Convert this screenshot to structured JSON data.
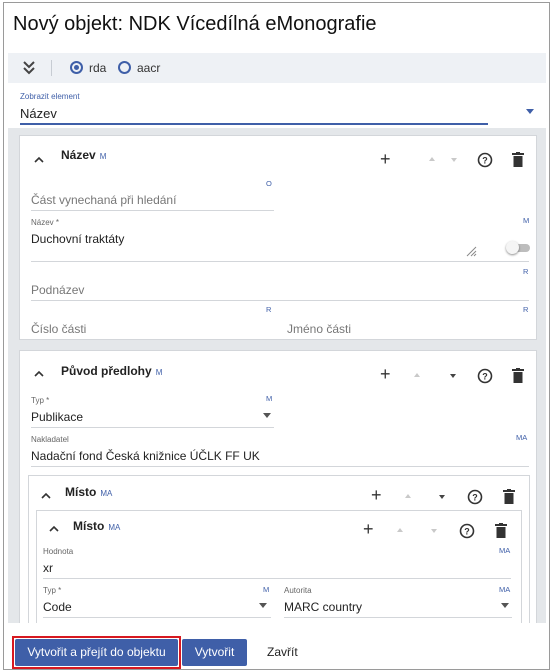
{
  "dialog": {
    "title": "Nový objekt: NDK Vícedílná eMonografie"
  },
  "toolbar": {
    "expand_icon": "double-chevron-down-icon",
    "radios": [
      {
        "label": "rda",
        "checked": true
      },
      {
        "label": "aacr",
        "checked": false
      }
    ]
  },
  "element_select": {
    "label": "Zobrazit element",
    "value": "Název"
  },
  "nazev_panel": {
    "title": "Název",
    "tag": "M",
    "fields": {
      "cast_vynechana": {
        "placeholder": "Část vynechaná při hledání",
        "tag": "O"
      },
      "nazev": {
        "label": "Název *",
        "value": "Duchovní traktáty",
        "tag": "M",
        "toggle_on": false
      },
      "podnazev": {
        "placeholder": "Podnázev",
        "tag": "R"
      },
      "cislo_casti": {
        "placeholder": "Číslo části",
        "tag": "R"
      },
      "jmeno_casti": {
        "placeholder": "Jméno části",
        "tag": "R"
      }
    }
  },
  "puvod_panel": {
    "title": "Původ předlohy",
    "tag": "M",
    "typ": {
      "label": "Typ *",
      "value": "Publikace",
      "tag": "M"
    },
    "nakladatel": {
      "label": "Nakladatel",
      "value": "Nadační fond Česká knižnice ÚČLK FF UK",
      "tag": "MA"
    }
  },
  "misto_outer": {
    "title": "Místo",
    "tag": "MA"
  },
  "misto_inner": {
    "title": "Místo",
    "tag": "MA",
    "hodnota": {
      "label": "Hodnota",
      "value": "xr",
      "tag": "MA"
    },
    "typ": {
      "label": "Typ *",
      "value": "Code",
      "tag": "M"
    },
    "autorita": {
      "label": "Autorita",
      "value": "MARC country",
      "tag": "MA"
    }
  },
  "footer": {
    "create_open_label": "Vytvořit a přejít do objektu",
    "create_label": "Vytvořit",
    "close_label": "Zavřít"
  },
  "colors": {
    "accent": "#3f5fa8",
    "highlight": "#d71920",
    "scroll_bg": "#e4e7ea"
  }
}
